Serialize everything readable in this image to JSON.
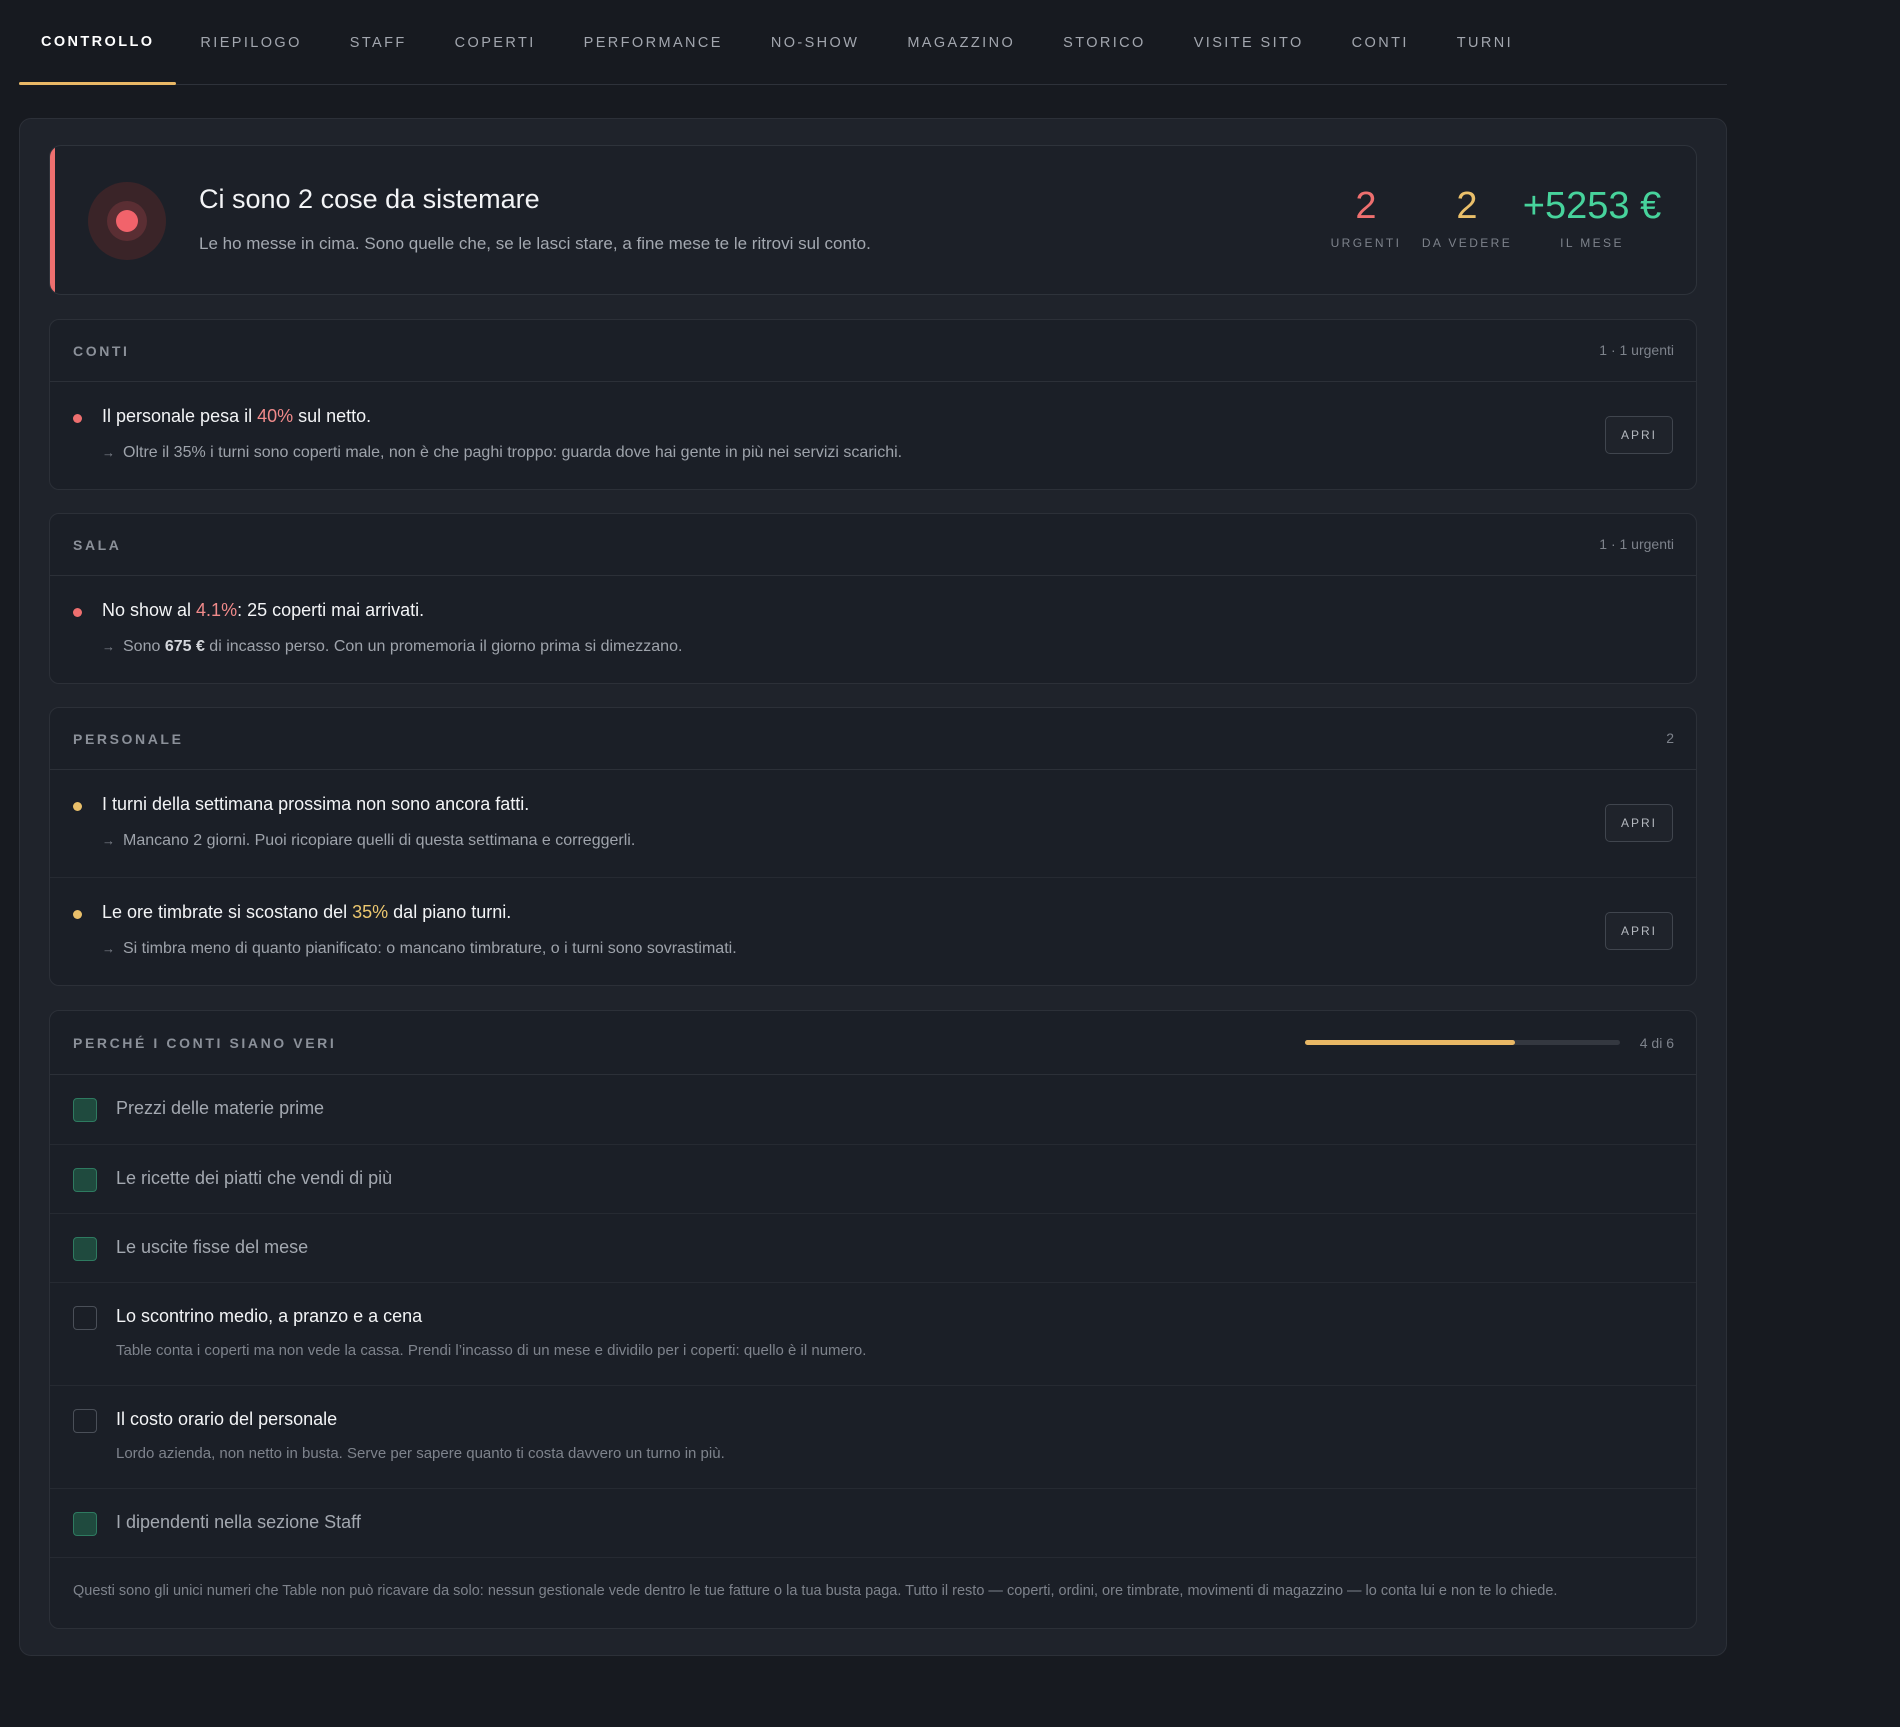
{
  "tabs": [
    {
      "label": "CONTROLLO",
      "active": true
    },
    {
      "label": "RIEPILOGO"
    },
    {
      "label": "STAFF"
    },
    {
      "label": "COPERTI"
    },
    {
      "label": "PERFORMANCE"
    },
    {
      "label": "NO-SHOW"
    },
    {
      "label": "MAGAZZINO"
    },
    {
      "label": "STORICO"
    },
    {
      "label": "VISITE SITO"
    },
    {
      "label": "CONTI"
    },
    {
      "label": "TURNI"
    }
  ],
  "hero": {
    "title": "Ci sono 2 cose da sistemare",
    "subtitle": "Le ho messe in cima. Sono quelle che, se le lasci stare, a fine mese te le ritrovi sul conto.",
    "stats": [
      {
        "value": "2",
        "label": "URGENTI"
      },
      {
        "value": "2",
        "label": "DA VEDERE"
      },
      {
        "value": "+5253 €",
        "label": "IL MESE"
      }
    ]
  },
  "sections": {
    "conti": {
      "title": "CONTI",
      "meta": "1 · 1 urgenti",
      "items": [
        {
          "pre": "Il personale pesa il ",
          "hl": "40%",
          "post": " sul netto.",
          "detail": "Oltre il 35% i turni sono coperti male, non è che paghi troppo: guarda dove hai gente in più nei servizi scarichi.",
          "button": "APRI"
        }
      ]
    },
    "sala": {
      "title": "SALA",
      "meta": "1 · 1 urgenti",
      "items": [
        {
          "pre": "No show al ",
          "hl": "4.1%",
          "post": ": 25 coperti mai arrivati.",
          "detail_pre": "Sono ",
          "detail_bold": "675 €",
          "detail_post": " di incasso perso. Con un promemoria il giorno prima si dimezzano."
        }
      ]
    },
    "personale": {
      "title": "PERSONALE",
      "meta": "2",
      "items": [
        {
          "text": "I turni della settimana prossima non sono ancora fatti.",
          "detail": "Mancano 2 giorni. Puoi ricopiare quelli di questa settimana e correggerli.",
          "button": "APRI"
        },
        {
          "pre": "Le ore timbrate si scostano del ",
          "hl": "35%",
          "post": " dal piano turni.",
          "detail": "Si timbra meno di quanto pianificato: o mancano timbrature, o i turni sono sovrastimati.",
          "button": "APRI"
        }
      ]
    },
    "checklist": {
      "title": "PERCHÉ I CONTI SIANO VERI",
      "progress_label": "4 di 6",
      "progress_fraction": 0.6667,
      "items": [
        {
          "label": "Prezzi delle materie prime",
          "done": true
        },
        {
          "label": "Le ricette dei piatti che vendi di più",
          "done": true
        },
        {
          "label": "Le uscite fisse del mese",
          "done": true
        },
        {
          "label": "Lo scontrino medio, a pranzo e a cena",
          "done": false,
          "desc": "Table conta i coperti ma non vede la cassa. Prendi l’incasso di un mese e dividilo per i coperti: quello è il numero."
        },
        {
          "label": "Il costo orario del personale",
          "done": false,
          "desc": "Lordo azienda, non netto in busta. Serve per sapere quanto ti costa davvero un turno in più."
        },
        {
          "label": "I dipendenti nella sezione Staff",
          "done": true
        }
      ],
      "footnote": "Questi sono gli unici numeri che Table non può ricavare da solo: nessun gestionale vede dentro le tue fatture o la tua busta paga. Tutto il resto — coperti, ordini, ore timbrate, movimenti di magazzino — lo conta lui e non te lo chiede."
    }
  },
  "colors": {
    "accent": "#e9b866",
    "urgent": "#ee6f6f",
    "warning": "#e9bf6a",
    "positive": "#47d39c",
    "check_done": "#1f4a3e"
  }
}
